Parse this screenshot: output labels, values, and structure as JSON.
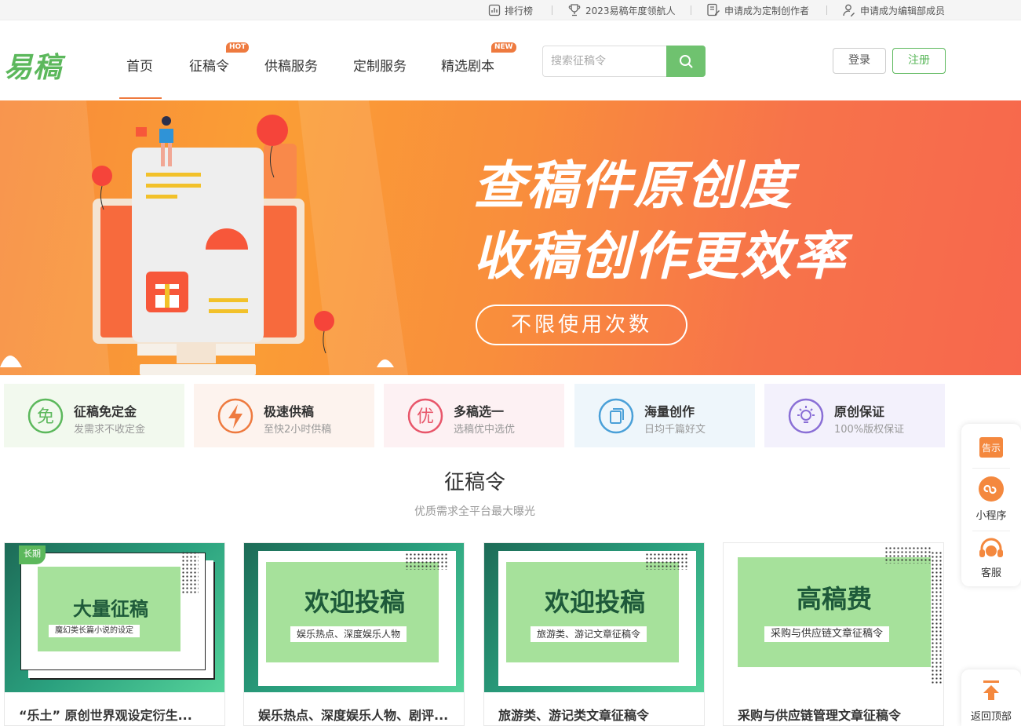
{
  "topbar": {
    "ranking": "排行榜",
    "navigator": "2023易稿年度领航人",
    "apply_creator": "申请成为定制创作者",
    "apply_editor": "申请成为编辑部成员"
  },
  "header": {
    "logo": "易稿",
    "nav": [
      "首页",
      "征稿令",
      "供稿服务",
      "定制服务",
      "精选剧本"
    ],
    "badge_hot": "HOT",
    "badge_new": "NEW",
    "search_placeholder": "搜索征稿令",
    "login": "登录",
    "register": "注册"
  },
  "banner": {
    "line1": "查稿件原创度",
    "line2": "收稿创作更效率",
    "button": "不限使用次数"
  },
  "features": [
    {
      "title": "征稿免定金",
      "sub": "发需求不收定金",
      "icon_text": "免",
      "color": "#5cb85c",
      "bg": "#f2f9ee"
    },
    {
      "title": "极速供稿",
      "sub": "至快2小时供稿",
      "icon_text": "",
      "color": "#ee7a3f",
      "bg": "#fdf3ee"
    },
    {
      "title": "多稿选一",
      "sub": "选稿优中选优",
      "icon_text": "优",
      "color": "#e8566a",
      "bg": "#fdf1f3"
    },
    {
      "title": "海量创作",
      "sub": "日均千篇好文",
      "icon_text": "",
      "color": "#4aa0d8",
      "bg": "#eef6fb"
    },
    {
      "title": "原创保证",
      "sub": "100%版权保证",
      "icon_text": "",
      "color": "#8a6fd6",
      "bg": "#f3f1fc"
    }
  ],
  "section": {
    "title": "征稿令",
    "subtitle": "优质需求全平台最大曝光"
  },
  "cards": [
    {
      "badge": "长期",
      "big": "大量征稿",
      "tagline": "魔幻类长篇小说的设定",
      "title": "“乐土” 原创世界观设定衍生..."
    },
    {
      "badge": "",
      "big": "欢迎投稿",
      "tagline": "娱乐热点、深度娱乐人物",
      "title": "娱乐热点、深度娱乐人物、剧评..."
    },
    {
      "badge": "",
      "big": "欢迎投稿",
      "tagline": "旅游类、游记文章征稿令",
      "title": "旅游类、游记类文章征稿令"
    },
    {
      "badge": "",
      "big": "高稿费",
      "tagline": "采购与供应链文章征稿令",
      "title": "采购与供应链管理文章征稿令"
    }
  ],
  "side": {
    "notice": "告示",
    "miniprogram": "小程序",
    "service": "客服",
    "backtop": "返回顶部"
  }
}
